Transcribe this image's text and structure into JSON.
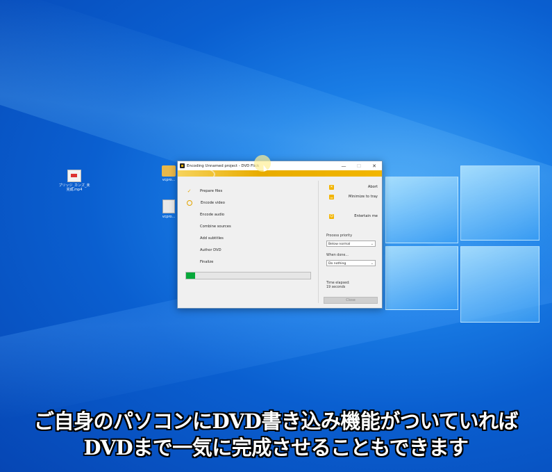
{
  "desktop": {
    "icons": [
      {
        "label": "ブリッジ_カンズ_未\n完成.mp4",
        "kind": "video-file"
      },
      {
        "label": "vcpro...",
        "kind": "folder"
      },
      {
        "label": "vcpro...",
        "kind": "document"
      }
    ]
  },
  "window": {
    "title": "Encoding Unnamed project - DVD Flick",
    "controls": {
      "minimize": "—",
      "maximize": "☐",
      "close": "✕"
    },
    "steps": [
      {
        "label": "Prepare files",
        "status": "done",
        "icon": "check-icon"
      },
      {
        "label": "Encode video",
        "status": "in-progress",
        "icon": "clock-icon"
      },
      {
        "label": "Encode audio",
        "status": "pending"
      },
      {
        "label": "Combine sources",
        "status": "pending"
      },
      {
        "label": "Add subtitles",
        "status": "pending"
      },
      {
        "label": "Author DVD",
        "status": "pending"
      },
      {
        "label": "Finalize",
        "status": "pending"
      }
    ],
    "progress": 0.07,
    "actions": {
      "abort": "Abort",
      "minimize_tray": "Minimize to tray",
      "entertain": "Entertain me"
    },
    "process_priority": {
      "label": "Process priority",
      "value": "Below normal"
    },
    "when_done": {
      "label": "When done...",
      "value": "Do nothing"
    },
    "time_elapsed": {
      "label": "Time elapsed:",
      "value": "19 seconds"
    },
    "close_label": "Close"
  },
  "subtitle": {
    "line1": "ご自身のパソコンにDVD書き込み機能がついていれば",
    "line2": "DVDまで一気に完成させることもできます"
  },
  "colors": {
    "accent": "#e9b000",
    "progress_fill": "#07a83a",
    "desktop_blue": "#0a5fd0"
  }
}
